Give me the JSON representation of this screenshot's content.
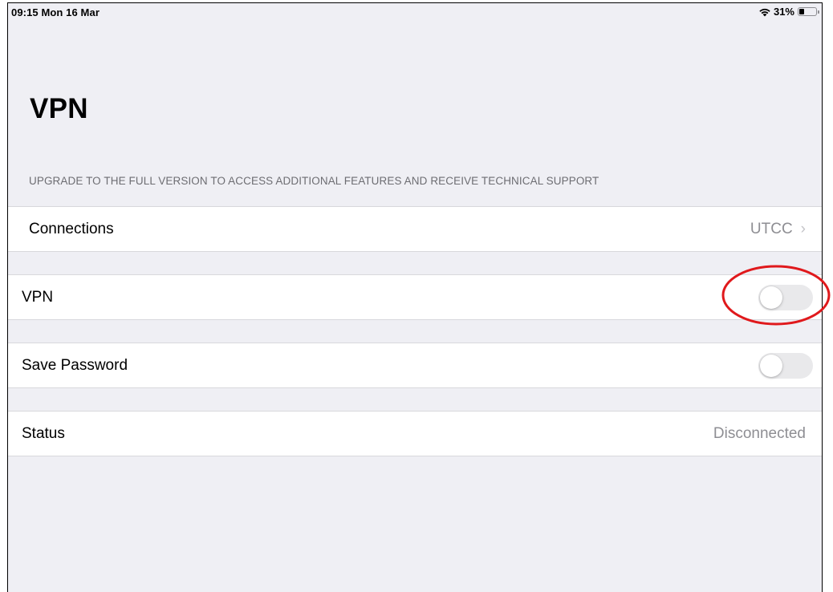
{
  "statusbar": {
    "time": "09:15 Mon 16 Mar",
    "battery_percent": "31%",
    "battery_level": 0.31
  },
  "page": {
    "title": "VPN",
    "section_header": "UPGRADE TO THE FULL VERSION TO ACCESS ADDITIONAL FEATURES AND RECEIVE TECHNICAL SUPPORT"
  },
  "rows": {
    "connections": {
      "label": "Connections",
      "value": "UTCC",
      "chevron": "›"
    },
    "vpn": {
      "label": "VPN",
      "on": false
    },
    "save_password": {
      "label": "Save Password",
      "on": false
    },
    "status": {
      "label": "Status",
      "value": "Disconnected"
    }
  },
  "annotation": {
    "color": "#e0191c"
  },
  "colors": {
    "background": "#efeff4",
    "toggle_off": "#e9e9eb",
    "secondary_text": "#8e8e93"
  }
}
